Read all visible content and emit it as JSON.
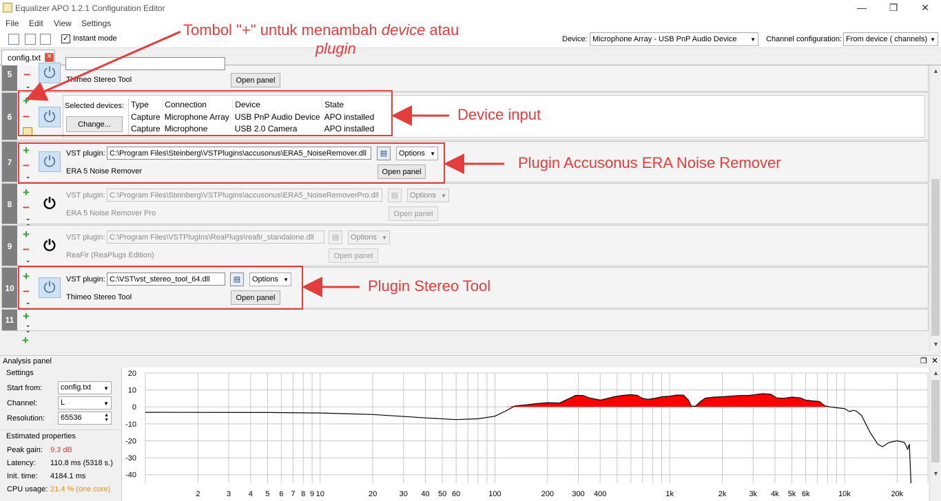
{
  "window": {
    "title": "Equalizer APO 1.2.1 Configuration Editor",
    "minimize": "—",
    "restore": "❐",
    "close": "✕"
  },
  "menu": [
    "File",
    "Edit",
    "View",
    "Settings"
  ],
  "toolbar": {
    "instant_mode_label": "Instant mode",
    "instant_mode_checked": "✓",
    "device_label": "Device:",
    "device_value": "Microphone Array - USB PnP Audio Device",
    "channel_config_label": "Channel configuration:",
    "channel_config_value": "From device ( channels)"
  },
  "tab": {
    "label": "config.txt",
    "close": "✕"
  },
  "rows": {
    "r5": {
      "num": "5",
      "plugin_name": "Thimeo Stereo Tool",
      "open_panel": "Open panel"
    },
    "r6": {
      "num": "6",
      "selected_devices_label": "Selected devices:",
      "change_button": "Change...",
      "headers": [
        "Type",
        "Connection",
        "Device",
        "State"
      ],
      "devices": [
        [
          "Capture",
          "Microphone Array",
          "USB PnP Audio Device",
          "APO installed"
        ],
        [
          "Capture",
          "Microphone",
          "USB 2.0 Camera",
          "APO installed"
        ]
      ]
    },
    "r7": {
      "num": "7",
      "vst_label": "VST plugin:",
      "path": "C:\\Program Files\\Steinberg\\VSTPlugins\\accusonus\\ERA5_NoiseRemover.dll",
      "options": "Options",
      "plugin_name": "ERA 5 Noise Remover",
      "open_panel": "Open panel"
    },
    "r8": {
      "num": "8",
      "vst_label": "VST plugin:",
      "path": "C:\\Program Files\\Steinberg\\VSTPlugins\\accusonus\\ERA5_NoiseRemoverPro.dll",
      "options": "Options",
      "plugin_name": "ERA 5 Noise Remover Pro",
      "open_panel": "Open panel"
    },
    "r9": {
      "num": "9",
      "vst_label": "VST plugin:",
      "path": "C:\\Program Files\\VSTPlugIns\\ReaPlugs\\reafir_standalone.dll",
      "options": "Options",
      "plugin_name": "ReaFir (ReaPlugs Edition)",
      "open_panel": "Open panel"
    },
    "r10": {
      "num": "10",
      "vst_label": "VST plugin:",
      "path": "C:\\VST\\vst_stereo_tool_64.dll",
      "options": "Options",
      "plugin_name": "Thimeo Stereo Tool",
      "open_panel": "Open panel"
    },
    "r11": {
      "num": "11"
    }
  },
  "annotations": {
    "add_button_line1": "Tombol \"+\" untuk menambah ",
    "add_button_italic1": "device",
    "add_button_line1b": " atau",
    "add_button_line2": "plugin",
    "device_input": "Device input",
    "plugin_era": "Plugin Accusonus ERA Noise Remover",
    "plugin_stereo": "Plugin Stereo Tool"
  },
  "analysis": {
    "title": "Analysis panel",
    "settings_title": "Settings",
    "start_from_label": "Start from:",
    "start_from_value": "config.txt",
    "channel_label": "Channel:",
    "channel_value": "L",
    "resolution_label": "Resolution:",
    "resolution_value": "65536",
    "estimated_title": "Estimated properties",
    "peak_gain_label": "Peak gain:",
    "peak_gain_value": "9.3 dB",
    "latency_label": "Latency:",
    "latency_value": "110.8 ms (5318 s.)",
    "init_time_label": "Init. time:",
    "init_time_value": "4184.1 ms",
    "cpu_label": "CPU usage:",
    "cpu_value": "21.4 % (one core)"
  },
  "chart_data": {
    "type": "area",
    "xscale": "log",
    "xlim": [
      1,
      30000
    ],
    "ylim": [
      -45,
      20
    ],
    "grid": true,
    "y_ticks": [
      20,
      10,
      0,
      -10,
      -20,
      -30,
      -40
    ],
    "x_tick_labels": [
      {
        "v": 2,
        "t": "2"
      },
      {
        "v": 3,
        "t": "3"
      },
      {
        "v": 4,
        "t": "4"
      },
      {
        "v": 5,
        "t": "5"
      },
      {
        "v": 6,
        "t": "6"
      },
      {
        "v": 7,
        "t": "7"
      },
      {
        "v": 8,
        "t": "8"
      },
      {
        "v": 9,
        "t": "9"
      },
      {
        "v": 10,
        "t": "10"
      },
      {
        "v": 20,
        "t": "20"
      },
      {
        "v": 30,
        "t": "30"
      },
      {
        "v": 40,
        "t": "40"
      },
      {
        "v": 50,
        "t": "50"
      },
      {
        "v": 60,
        "t": "60"
      },
      {
        "v": 100,
        "t": "100"
      },
      {
        "v": 200,
        "t": "200"
      },
      {
        "v": 300,
        "t": "300"
      },
      {
        "v": 400,
        "t": "400"
      },
      {
        "v": 1000,
        "t": "1k"
      },
      {
        "v": 2000,
        "t": "2k"
      },
      {
        "v": 3000,
        "t": "3k"
      },
      {
        "v": 4000,
        "t": "4k"
      },
      {
        "v": 5000,
        "t": "5k"
      },
      {
        "v": 6000,
        "t": "6k"
      },
      {
        "v": 10000,
        "t": "10k"
      },
      {
        "v": 20000,
        "t": "20k"
      }
    ],
    "response": [
      [
        1,
        -3.2
      ],
      [
        5,
        -3.3
      ],
      [
        10,
        -3.6
      ],
      [
        20,
        -4.5
      ],
      [
        40,
        -6.5
      ],
      [
        60,
        -7.5
      ],
      [
        80,
        -7.0
      ],
      [
        100,
        -5.5
      ],
      [
        115,
        -2.5
      ],
      [
        130,
        0.5
      ],
      [
        150,
        1.2
      ],
      [
        175,
        2.0
      ],
      [
        200,
        2.5
      ],
      [
        235,
        2.3
      ],
      [
        260,
        4.5
      ],
      [
        290,
        6.8
      ],
      [
        320,
        6.7
      ],
      [
        350,
        5.2
      ],
      [
        400,
        4.0
      ],
      [
        440,
        5.0
      ],
      [
        480,
        6.0
      ],
      [
        540,
        6.8
      ],
      [
        600,
        7.2
      ],
      [
        650,
        6.8
      ],
      [
        700,
        5.0
      ],
      [
        750,
        4.5
      ],
      [
        820,
        5.0
      ],
      [
        900,
        6.0
      ],
      [
        1000,
        6.3
      ],
      [
        1100,
        7.0
      ],
      [
        1200,
        6.9
      ],
      [
        1280,
        4.0
      ],
      [
        1330,
        0.5
      ],
      [
        1400,
        0.3
      ],
      [
        1500,
        3.2
      ],
      [
        1600,
        5.2
      ],
      [
        1800,
        5.8
      ],
      [
        2000,
        6.0
      ],
      [
        2200,
        6.3
      ],
      [
        2500,
        6.7
      ],
      [
        2800,
        6.7
      ],
      [
        3100,
        7.3
      ],
      [
        3400,
        7.8
      ],
      [
        3800,
        7.4
      ],
      [
        4100,
        5.3
      ],
      [
        4500,
        5.1
      ],
      [
        5000,
        5.8
      ],
      [
        5600,
        5.3
      ],
      [
        6000,
        4.0
      ],
      [
        6600,
        3.5
      ],
      [
        7200,
        3.2
      ],
      [
        7700,
        0.7
      ],
      [
        8200,
        0
      ],
      [
        9000,
        -0.5
      ],
      [
        10000,
        -1.0
      ],
      [
        10700,
        -2.8
      ],
      [
        11200,
        -2.0
      ],
      [
        11700,
        -2.5
      ],
      [
        12500,
        -5
      ],
      [
        14000,
        -15
      ],
      [
        15500,
        -22
      ],
      [
        16500,
        -23.5
      ],
      [
        18000,
        -21
      ],
      [
        20000,
        -20
      ],
      [
        22000,
        -21
      ],
      [
        23000,
        -25
      ],
      [
        23500,
        -22
      ],
      [
        24000,
        -45
      ]
    ]
  }
}
